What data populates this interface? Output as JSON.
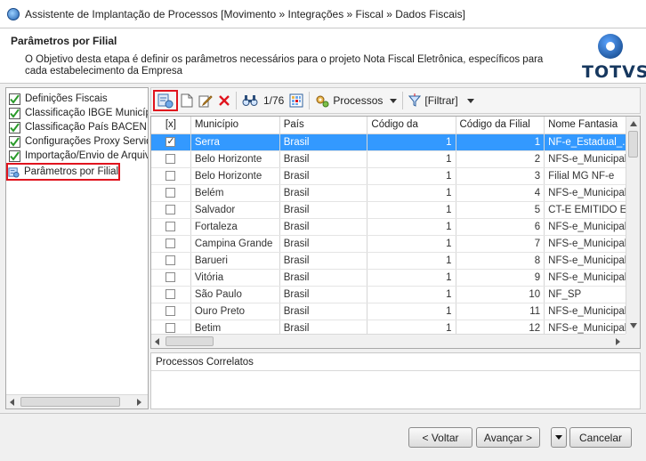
{
  "window": {
    "title": "Assistente de Implantação de Processos [Movimento » Integrações » Fiscal » Dados Fiscais]"
  },
  "header": {
    "title": "Parâmetros por Filial",
    "description": "O Objetivo desta etapa é definir os parâmetros necessários para o projeto Nota Fiscal Eletrônica, específicos para cada estabelecimento da Empresa",
    "logo_text": "TOTVS"
  },
  "steps": [
    {
      "label": "Definições Fiscais",
      "checked": true
    },
    {
      "label": "Classificação IBGE Municípios",
      "checked": true
    },
    {
      "label": "Classificação País BACEN",
      "checked": true
    },
    {
      "label": "Configurações Proxy Servidor",
      "checked": true
    },
    {
      "label": "Importação/Envio de Arquivos",
      "checked": true
    },
    {
      "label": "Parâmetros por Filial",
      "checked": false,
      "current": true
    }
  ],
  "toolbar": {
    "record_counter": "1/76",
    "processos_label": "Processos",
    "filtrar_label": "[Filtrar]"
  },
  "grid": {
    "columns": [
      "[x]",
      "Município",
      "País",
      "Código da",
      "Código da Filial",
      "Nome Fantasia"
    ],
    "rows": [
      {
        "checked": true,
        "municipio": "Serra",
        "pais": "Brasil",
        "codigo": "1",
        "filial": "1",
        "nome": "NF-e_Estadual_..."
      },
      {
        "checked": false,
        "municipio": "Belo Horizonte",
        "pais": "Brasil",
        "codigo": "1",
        "filial": "2",
        "nome": "NFS-e_Municipal..."
      },
      {
        "checked": false,
        "municipio": "Belo Horizonte",
        "pais": "Brasil",
        "codigo": "1",
        "filial": "3",
        "nome": "Filial MG NF-e"
      },
      {
        "checked": false,
        "municipio": "Belém",
        "pais": "Brasil",
        "codigo": "1",
        "filial": "4",
        "nome": "NFS-e_Municipal..."
      },
      {
        "checked": false,
        "municipio": "Salvador",
        "pais": "Brasil",
        "codigo": "1",
        "filial": "5",
        "nome": "CT-E EMITIDO E..."
      },
      {
        "checked": false,
        "municipio": "Fortaleza",
        "pais": "Brasil",
        "codigo": "1",
        "filial": "6",
        "nome": "NFS-e_Municipal..."
      },
      {
        "checked": false,
        "municipio": "Campina Grande",
        "pais": "Brasil",
        "codigo": "1",
        "filial": "7",
        "nome": "NFS-e_Municipal..."
      },
      {
        "checked": false,
        "municipio": "Barueri",
        "pais": "Brasil",
        "codigo": "1",
        "filial": "8",
        "nome": "NFS-e_Municipal..."
      },
      {
        "checked": false,
        "municipio": "Vitória",
        "pais": "Brasil",
        "codigo": "1",
        "filial": "9",
        "nome": "NFS-e_Municipal..."
      },
      {
        "checked": false,
        "municipio": "São Paulo",
        "pais": "Brasil",
        "codigo": "1",
        "filial": "10",
        "nome": "NF_SP"
      },
      {
        "checked": false,
        "municipio": "Ouro Preto",
        "pais": "Brasil",
        "codigo": "1",
        "filial": "11",
        "nome": "NFS-e_Municipal..."
      },
      {
        "checked": false,
        "municipio": "Betim",
        "pais": "Brasil",
        "codigo": "1",
        "filial": "12",
        "nome": "NFS-e_Municipal..."
      }
    ]
  },
  "related": {
    "title": "Processos Correlatos"
  },
  "footer": {
    "back_label": "< Voltar",
    "next_label": "Avançar >",
    "cancel_label": "Cancelar"
  },
  "colors": {
    "selection": "#3399ff",
    "highlight": "#e0141e",
    "brand": "#17385f"
  }
}
